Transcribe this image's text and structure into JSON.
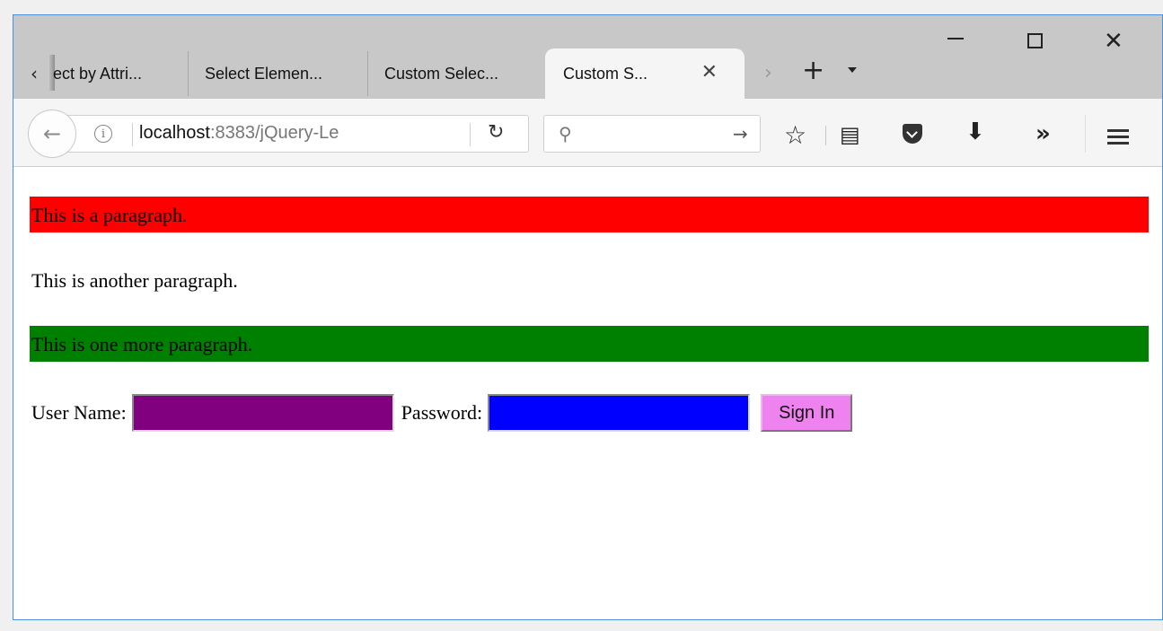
{
  "browser": {
    "tabs": [
      {
        "label": "ect by Attri..."
      },
      {
        "label": "Select Elemen..."
      },
      {
        "label": "Custom Selec..."
      },
      {
        "label": "Custom S..."
      }
    ],
    "active_tab_index": 3,
    "url": {
      "host": "localhost",
      "rest": ":8383/jQuery-Le"
    },
    "search_placeholder": ""
  },
  "page": {
    "paragraphs": [
      {
        "text": "This is a paragraph.",
        "background": "#ff0000"
      },
      {
        "text": "This is another paragraph.",
        "background": "#ffffff"
      },
      {
        "text": "This is one more paragraph.",
        "background": "#008000"
      }
    ],
    "form": {
      "username_label": "User Name:",
      "username_value": "",
      "username_bg": "#800080",
      "password_label": "Password:",
      "password_value": "",
      "password_bg": "#0000ff",
      "signin_label": "Sign In",
      "signin_bg": "#ee82ee"
    }
  }
}
